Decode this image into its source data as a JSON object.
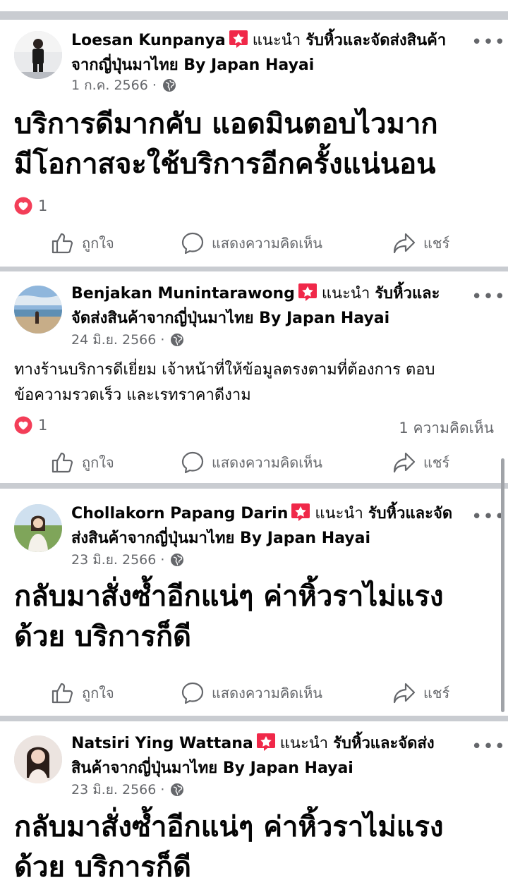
{
  "posts": [
    {
      "author": "Loesan Kunpanya",
      "recommend": "แนะนำ",
      "page_line1": "รับหิ้วและจัดส่งสินค้า",
      "page_line2": "จากญี่ปุ่นมาไทย By Japan Hayai",
      "date": "1 ก.ค. 2566 ·",
      "body_line1": "บริการดีมากคับ แอดมินตอบไวมาก",
      "body_line2": "มีโอกาสจะใช้บริการอีกครั้งแน่นอน",
      "reactions": "1",
      "comments": "",
      "avatar_icon": "person-photo"
    },
    {
      "author": "Benjakan Munintarawong",
      "recommend": "แนะนำ",
      "page_line1": "รับหิ้วและ",
      "page_line2": "จัดส่งสินค้าจากญี่ปุ่นมาไทย By Japan Hayai",
      "date": "24 มิ.ย. 2566 ·",
      "body_line1": "ทางร้านบริการดีเยี่ยม เจ้าหน้าที่ให้ข้อมูลตรงตามที่ต้องการ ตอบ",
      "body_line2": "ข้อความรวดเร็ว และเรทราคาดีงาม",
      "reactions": "1",
      "comments": "1 ความคิดเห็น",
      "avatar_icon": "beach-photo"
    },
    {
      "author": "Chollakorn Papang Darin",
      "recommend": "แนะนำ",
      "page_line1": "รับหิ้วและจัด",
      "page_line2": "ส่งสินค้าจากญี่ปุ่นมาไทย By Japan Hayai",
      "date": "23 มิ.ย. 2566 ·",
      "body_line1": "กลับมาสั่งซ้ำอีกแน่ๆ ค่าหิ้วราไม่แรง",
      "body_line2": "ด้วย บริการก็ดี",
      "reactions": "",
      "comments": "",
      "avatar_icon": "field-photo"
    },
    {
      "author": "Natsiri Ying Wattana",
      "recommend": "แนะนำ",
      "page_line1": "รับหิ้วและจัดส่ง",
      "page_line2": "สินค้าจากญี่ปุ่นมาไทย By Japan Hayai",
      "date": "23 มิ.ย. 2566 ·",
      "body_line1": "กลับมาสั่งซ้ำอีกแน่ๆ ค่าหิ้วราไม่แรง",
      "body_line2": "ด้วย บริการก็ดี",
      "reactions": "",
      "comments": "",
      "avatar_icon": "portrait-photo"
    }
  ],
  "actions": {
    "like": "ถูกใจ",
    "comment": "แสดงความคิดเห็น",
    "share": "แชร์"
  },
  "colors": {
    "background": "#c9ccd1",
    "card": "#ffffff",
    "secondary_text": "#65676b",
    "badge": "#f02849",
    "heart": "#f33e58"
  }
}
